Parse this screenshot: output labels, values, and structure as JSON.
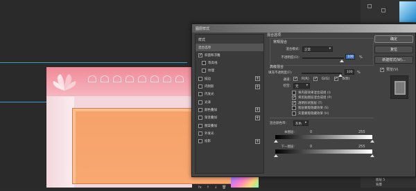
{
  "dialog": {
    "title": "图层样式",
    "styles_header": "样式",
    "style_items": [
      {
        "label": "混合选项",
        "checked": null,
        "plus": false
      },
      {
        "label": "斜面和浮雕",
        "checked": true,
        "plus": false
      },
      {
        "label": "等高线",
        "checked": false,
        "plus": false
      },
      {
        "label": "纹理",
        "checked": false,
        "plus": false
      },
      {
        "label": "描边",
        "checked": false,
        "plus": true
      },
      {
        "label": "内阴影",
        "checked": false,
        "plus": true
      },
      {
        "label": "内发光",
        "checked": false,
        "plus": false
      },
      {
        "label": "光泽",
        "checked": false,
        "plus": false
      },
      {
        "label": "颜色叠加",
        "checked": false,
        "plus": true
      },
      {
        "label": "渐变叠加",
        "checked": false,
        "plus": true
      },
      {
        "label": "图案叠加",
        "checked": false,
        "plus": false
      },
      {
        "label": "外发光",
        "checked": false,
        "plus": false
      },
      {
        "label": "投影",
        "checked": false,
        "plus": true
      }
    ],
    "footer_icons": [
      "fx",
      "↑",
      "↓",
      "🗑"
    ],
    "blend": {
      "section": "混合选项",
      "general": "常规混合",
      "mode_label": "混合模式:",
      "mode_value": "正常",
      "opacity_label": "不透明度(O):",
      "opacity_value": "100",
      "opacity_unit": "%",
      "advanced": "高级混合",
      "fill_label": "填充不透明度(F):",
      "fill_value": "100",
      "fill_unit": "%",
      "channels_label": "通道:",
      "channels": [
        "R(R)",
        "G(G)",
        "B(B)"
      ],
      "knockout_label": "挖空:",
      "knockout_value": "无",
      "options": [
        {
          "label": "将内部效果混合成组 (I)",
          "checked": false
        },
        {
          "label": "将剪贴图层混合成组 (P)",
          "checked": true
        },
        {
          "label": "透明形状图层 (T)",
          "checked": true
        },
        {
          "label": "图层蒙版隐藏效果 (S)",
          "checked": false
        },
        {
          "label": "矢量蒙版隐藏效果 (H)",
          "checked": false
        }
      ],
      "blend_if_label": "混合颜色带:",
      "blend_if_value": "灰色",
      "this_layer_label": "本图层:",
      "this_layer_min": "0",
      "this_layer_max": "255",
      "under_layer_label": "下一图层:",
      "under_layer_min": "0",
      "under_layer_max": "255"
    },
    "buttons": {
      "ok": "确定",
      "reset": "复位",
      "new_style": "新建样式(W)...",
      "preview": "预览(V)"
    }
  },
  "right_panel": {
    "layer_rows": [
      "图层 5",
      "背景"
    ]
  }
}
